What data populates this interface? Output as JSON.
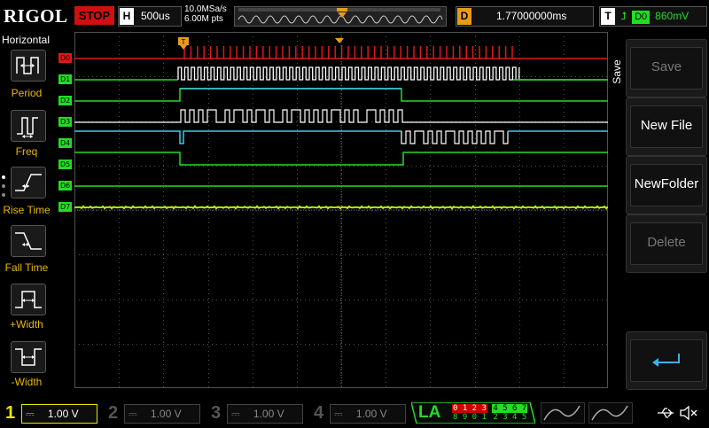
{
  "topbar": {
    "brand": "RIGOL",
    "run_state": "STOP",
    "horizontal_tag": "H",
    "timebase": "500us",
    "sample_rate": "10.0MSa/s",
    "memory_depth": "6.00M pts",
    "delay_tag": "D",
    "delay": "1.77000000ms",
    "trigger_tag": "T",
    "trigger_source": "D0",
    "trigger_level": "860mV"
  },
  "left_panel": {
    "title": "Horizontal",
    "items": [
      {
        "label": "Period",
        "icon": "period-icon"
      },
      {
        "label": "Freq",
        "icon": "freq-icon"
      },
      {
        "label": "Rise Time",
        "icon": "rise-time-icon"
      },
      {
        "label": "Fall Time",
        "icon": "fall-time-icon"
      },
      {
        "label": "+Width",
        "icon": "positive-width-icon"
      },
      {
        "label": "-Width",
        "icon": "negative-width-icon"
      }
    ]
  },
  "right_panel": {
    "title": "Save",
    "buttons": [
      {
        "label": "Save",
        "enabled": false
      },
      {
        "label": "New File",
        "enabled": true
      },
      {
        "label": "NewFolder",
        "enabled": true
      },
      {
        "label": "Delete",
        "enabled": false
      },
      {
        "label": "",
        "icon": "return-icon",
        "enabled": true
      }
    ]
  },
  "trace_labels": [
    "D0",
    "D1",
    "D2",
    "D3",
    "D4",
    "D5",
    "D6",
    "D7"
  ],
  "bottombar": {
    "channels": [
      {
        "num": "1",
        "scale": "1.00 V",
        "color": "#e8e800"
      },
      {
        "num": "2",
        "scale": "1.00 V",
        "color": "#3fb0c8"
      },
      {
        "num": "3",
        "scale": "1.00 V",
        "color": "#c020c0"
      },
      {
        "num": "4",
        "scale": "1.00 V",
        "color": "#2a6fd0"
      }
    ],
    "la_label": "LA",
    "la_upper_left": "0 1 2 3",
    "la_upper_right": "4 5 6 7",
    "la_lower_left": "8 9 0 1",
    "la_lower_right": "2 3 4 5"
  },
  "colors": {
    "grid": "#505050",
    "trace_red": "#e01818",
    "trace_green": "#22dd22",
    "trace_cyan": "#3fc8e8",
    "trace_white": "#ffffff",
    "trace_yellow": "#e8e800",
    "accent_orange": "#e89b1b"
  }
}
